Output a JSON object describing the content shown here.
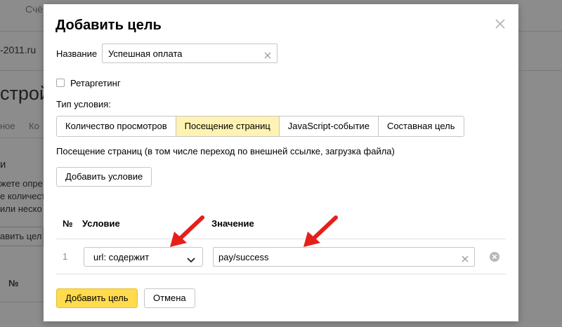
{
  "background": {
    "header_text": "Счё",
    "site": "-2011.ru",
    "heading": "строй",
    "tabs_text_1": "ное",
    "tabs_text_2": "Ко",
    "side_title": "и",
    "lines": [
      "жете опре",
      "е количест",
      " или неско"
    ],
    "button_text": "авить цел",
    "table_num": "№"
  },
  "modal": {
    "title": "Добавить цель",
    "name_label": "Название",
    "name_value": "Успешная оплата",
    "retargeting_label": "Ретаргетинг",
    "retargeting_checked": false,
    "condition_type_label": "Тип условия:",
    "condition_types": [
      {
        "label": "Количество просмотров",
        "active": false
      },
      {
        "label": "Посещение страниц",
        "active": true
      },
      {
        "label": "JavaScript-событие",
        "active": false
      },
      {
        "label": "Составная цель",
        "active": false
      }
    ],
    "condition_description": "Посещение страниц (в том числе переход по внешней ссылке, загрузка файла)",
    "add_condition_button": "Добавить условие",
    "table": {
      "headers": {
        "num": "№",
        "condition": "Условие",
        "value": "Значение"
      },
      "rows": [
        {
          "num": "1",
          "condition": "url: содержит",
          "value": "pay/success"
        }
      ]
    },
    "submit_button": "Добавить цель",
    "cancel_button": "Отмена"
  },
  "colors": {
    "accent": "#ffdb4d",
    "active_segment": "#fff3b3",
    "annotation_arrow": "#e5201b",
    "overlay": "#8c8c8c"
  }
}
